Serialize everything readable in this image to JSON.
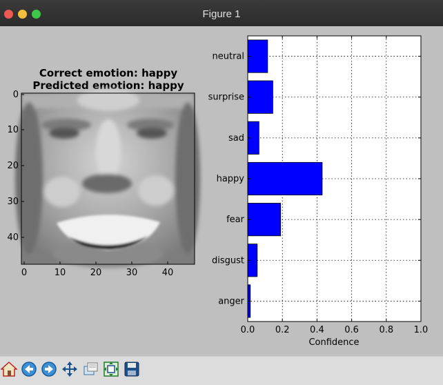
{
  "window": {
    "title": "Figure 1"
  },
  "image_panel": {
    "title_line1": "Correct emotion: happy",
    "title_line2": "Predicted emotion: happy",
    "x_ticks": [
      "0",
      "10",
      "20",
      "30",
      "40"
    ],
    "y_ticks": [
      "0",
      "10",
      "20",
      "30",
      "40"
    ]
  },
  "chart_data": {
    "type": "bar",
    "orientation": "horizontal",
    "categories": [
      "anger",
      "disgust",
      "fear",
      "happy",
      "sad",
      "surprise",
      "neutral"
    ],
    "values": [
      0.015,
      0.055,
      0.19,
      0.43,
      0.065,
      0.145,
      0.115
    ],
    "xlabel": "Confidence",
    "xlim": [
      0.0,
      1.0
    ],
    "x_ticks": [
      "0.0",
      "0.2",
      "0.4",
      "0.6",
      "0.8",
      "1.0"
    ],
    "grid": true,
    "bar_color": "#0000ff"
  },
  "toolbar": {
    "buttons": [
      "home-icon",
      "back-arrow-icon",
      "forward-arrow-icon",
      "pan-icon",
      "zoom-icon",
      "subplots-icon",
      "save-icon"
    ]
  }
}
